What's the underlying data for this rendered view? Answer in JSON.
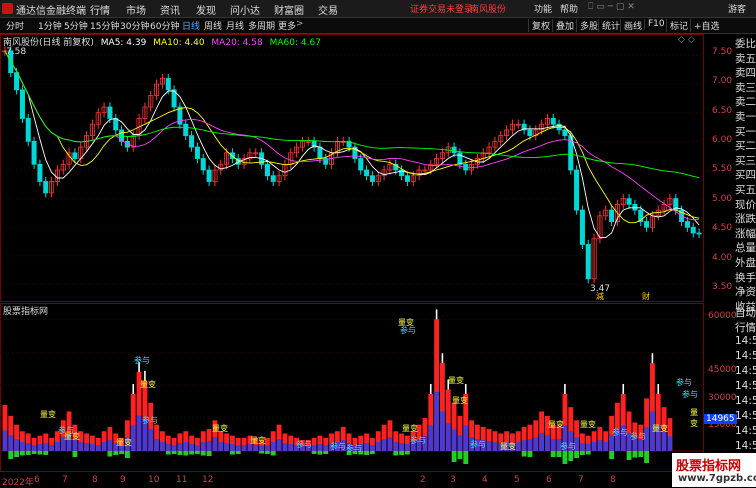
{
  "menubar": {
    "app_name": "通达信金融终端",
    "menus": [
      "行情",
      "市场",
      "资讯",
      "发现",
      "问小达",
      "财富圈",
      "交易"
    ],
    "notice": "证券交易未登录",
    "stock": "南风股份",
    "right": [
      "功能",
      "帮助",
      "游客"
    ]
  },
  "toolbar": {
    "periods": [
      "分时",
      "1分钟",
      "5分钟",
      "15分钟",
      "30分钟",
      "60分钟",
      "日线",
      "周线",
      "月线",
      "多周期",
      "更多"
    ],
    "active_period": "日线",
    "tools": [
      "复权",
      "叠加",
      "多股",
      "统计",
      "画线",
      "F10",
      "标记",
      "+自选"
    ]
  },
  "main_panel": {
    "title": "南风股份(日线 前复权)",
    "ma": [
      {
        "label": "MA5: 4.39",
        "color": "#ffffff"
      },
      {
        "label": "MA10: 4.40",
        "color": "#ffff00"
      },
      {
        "label": "MA20: 4.58",
        "color": "#ff40ff"
      },
      {
        "label": "MA60: 4.67",
        "color": "#00ff00"
      }
    ],
    "high_label": "7.58",
    "low_label": "3.47",
    "markers": [
      "減",
      "财"
    ],
    "price_axis": [
      "7.50",
      "7.00",
      "6.50",
      "6.00",
      "5.50",
      "5.00",
      "4.50",
      "4.00",
      "3.50"
    ]
  },
  "indicator_panel": {
    "title": "股票指标网",
    "axis": [
      "60000",
      "45000",
      "30000",
      "15000"
    ],
    "current_value": "14965",
    "annotations": [
      "量变",
      "参与",
      "量变",
      "参与",
      "量变",
      "参与",
      "量变",
      "量变",
      "量变",
      "参与",
      "参与",
      "量变",
      "参与",
      "量变",
      "量变",
      "量变",
      "量变",
      "参与",
      "参与",
      "量变",
      "参与",
      "参与",
      "量变",
      "参与",
      "参与",
      "量变",
      "量变",
      "参与",
      "参与"
    ]
  },
  "right_panel": {
    "items": [
      "委比",
      "卖五",
      "卖四",
      "卖三",
      "卖二",
      "卖一",
      "买一",
      "买二",
      "买三",
      "买四",
      "买五",
      "现价",
      "涨跌",
      "涨幅",
      "总量",
      "外盘",
      "换手",
      "净资",
      "收益"
    ],
    "items2": [
      "自动",
      "行情",
      "14:5",
      "14:5",
      "14:5",
      "14:5",
      "14:5",
      "14:5",
      "14:5",
      "14:5",
      "14:5"
    ]
  },
  "date_axis": [
    "2022年",
    "6",
    "7",
    "8",
    "9",
    "10",
    "11",
    "12",
    "2",
    "3",
    "4",
    "5",
    "6",
    "7",
    "8"
  ],
  "watermark": {
    "title": "股票指标网",
    "url": "www.7gpzb.com"
  },
  "chart_data": {
    "type": "candlestick",
    "price_range": [
      3.3,
      7.7
    ],
    "close": [
      7.58,
      7.2,
      6.9,
      6.4,
      6.0,
      5.6,
      5.3,
      5.1,
      5.3,
      5.5,
      5.6,
      5.8,
      5.7,
      5.9,
      6.1,
      6.3,
      6.5,
      6.6,
      6.4,
      6.2,
      6.0,
      5.9,
      6.1,
      6.4,
      6.6,
      6.8,
      7.0,
      7.1,
      6.9,
      6.6,
      6.3,
      6.1,
      5.9,
      5.7,
      5.5,
      5.3,
      5.5,
      5.6,
      5.8,
      5.7,
      5.6,
      5.7,
      5.8,
      5.8,
      5.6,
      5.4,
      5.3,
      5.4,
      5.6,
      5.8,
      5.9,
      6.0,
      6.0,
      5.9,
      5.7,
      5.6,
      5.8,
      6.0,
      6.0,
      5.9,
      5.7,
      5.5,
      5.4,
      5.3,
      5.4,
      5.5,
      5.6,
      5.5,
      5.4,
      5.3,
      5.4,
      5.5,
      5.5,
      5.6,
      5.7,
      5.8,
      5.9,
      5.8,
      5.6,
      5.5,
      5.6,
      5.7,
      5.8,
      5.9,
      6.0,
      6.1,
      6.2,
      6.3,
      6.3,
      6.2,
      6.1,
      6.2,
      6.3,
      6.4,
      6.3,
      6.2,
      6.1,
      5.5,
      4.8,
      4.2,
      3.6,
      4.3,
      4.7,
      4.8,
      4.6,
      4.9,
      5.0,
      4.9,
      4.8,
      4.6,
      4.5,
      4.7,
      4.8,
      4.9,
      5.0,
      4.8,
      4.6,
      4.5,
      4.4,
      4.39
    ],
    "volume": [
      21000,
      16000,
      12000,
      9000,
      8000,
      6000,
      7000,
      8000,
      6000,
      9000,
      14000,
      18000,
      12000,
      9000,
      8000,
      7000,
      6000,
      9000,
      11000,
      8000,
      6000,
      14000,
      26000,
      36000,
      32000,
      22000,
      12000,
      9000,
      7000,
      6000,
      8000,
      9000,
      7000,
      6000,
      9000,
      10000,
      14000,
      9000,
      8000,
      7000,
      6000,
      6000,
      7000,
      6000,
      5000,
      6000,
      9000,
      12000,
      8000,
      7000,
      6000,
      5000,
      5000,
      6000,
      7000,
      6000,
      8000,
      9000,
      11000,
      8000,
      6000,
      7000,
      8000,
      6000,
      9000,
      12000,
      14000,
      9000,
      8000,
      7000,
      9000,
      12000,
      15000,
      26000,
      60000,
      40000,
      28000,
      22000,
      16000,
      26000,
      14000,
      12000,
      11000,
      10000,
      9000,
      8000,
      9000,
      8000,
      9000,
      11000,
      12000,
      14000,
      18000,
      16000,
      12000,
      12000,
      26000,
      20000,
      14000,
      8000,
      7000,
      9000,
      11000,
      9000,
      16000,
      22000,
      26000,
      18000,
      13000,
      12000,
      24000,
      40000,
      26000,
      20000,
      14965
    ]
  }
}
